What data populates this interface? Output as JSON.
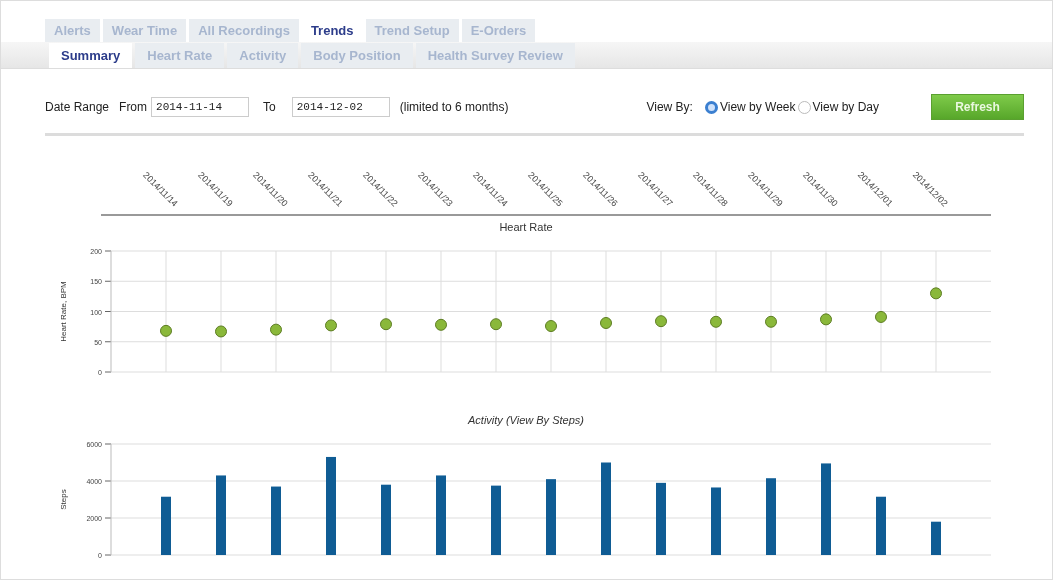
{
  "tabs": [
    {
      "label": "Alerts",
      "selected": false
    },
    {
      "label": "Wear Time",
      "selected": false
    },
    {
      "label": "All Recordings",
      "selected": false
    },
    {
      "label": "Trends",
      "selected": true
    },
    {
      "label": "Trend Setup",
      "selected": false
    },
    {
      "label": "E-Orders",
      "selected": false
    }
  ],
  "subtabs": [
    {
      "label": "Summary",
      "selected": true
    },
    {
      "label": "Heart Rate",
      "selected": false
    },
    {
      "label": "Activity",
      "selected": false
    },
    {
      "label": "Body Position",
      "selected": false
    },
    {
      "label": "Health Survey Review",
      "selected": false
    }
  ],
  "filter": {
    "label": "Date Range",
    "from_label": "From",
    "from": "2014-11-14",
    "to_label": "To",
    "to": "2014-12-02",
    "note": "(limited to 6 months)",
    "view_by_label": "View By:",
    "options": [
      {
        "label": "View by Week",
        "selected": true
      },
      {
        "label": "View by Day",
        "selected": false
      }
    ],
    "button": "Refresh"
  },
  "charts": [
    {
      "chart_data": {
        "type": "scatter",
        "title": "Heart Rate",
        "ylabel": "Heart Rate, BPM",
        "ylim": [
          0,
          200
        ],
        "yticks": [
          0,
          50,
          100,
          150,
          200
        ],
        "x": [
          "2014/11/14",
          "2014/11/19",
          "2014/11/20",
          "2014/11/21",
          "2014/11/22",
          "2014/11/23",
          "2014/11/24",
          "2014/11/25",
          "2014/11/26",
          "2014/11/27",
          "2014/11/28",
          "2014/11/29",
          "2014/11/30",
          "2014/12/01",
          "2014/12/02"
        ],
        "grid": true,
        "series": [
          {
            "color": "#8ab83a",
            "values": [
              68,
              67,
              70,
              77,
              79,
              78,
              79,
              76,
              81,
              84,
              83,
              83,
              87,
              91,
              130
            ]
          }
        ]
      }
    },
    {
      "chart_data": {
        "type": "bar",
        "title": "Activity (View By Steps)",
        "ylabel": "Steps",
        "ylim": [
          0,
          6000
        ],
        "yticks": [
          0,
          2000,
          4000,
          6000
        ],
        "grid": true,
        "series": [
          {
            "color": "#0f5c94",
            "values": [
              3150,
              4300,
              3700,
              5300,
              3800,
              4300,
              3750,
              4100,
              5000,
              3900,
              3650,
              4150,
              4950,
              3150,
              1800
            ]
          }
        ]
      }
    }
  ]
}
